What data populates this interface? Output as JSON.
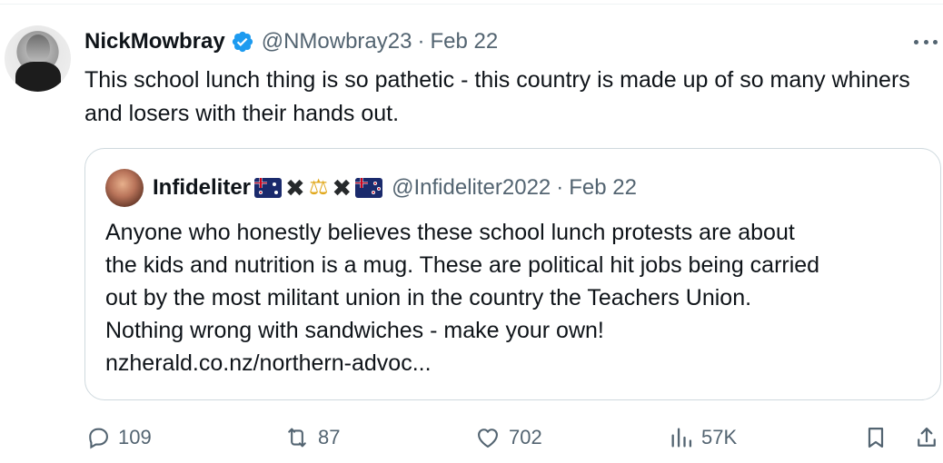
{
  "tweet": {
    "author_name": "NickMowbray",
    "handle": "@NMowbray23",
    "separator": "·",
    "date": "Feb 22",
    "text": "This school lunch thing is so pathetic - this country is made up of so many whiners and losers with their hands out.",
    "verified_icon": "verified-badge-icon",
    "more_icon": "more-horizontal-icon"
  },
  "quoted_tweet": {
    "author_name": "Infideliter",
    "name_emojis": [
      "🇦🇺",
      "✖",
      "⚖",
      "✖",
      "🇳🇿"
    ],
    "handle": "@Infideliter2022",
    "separator": "·",
    "date": "Feb 22",
    "text_lines": [
      "Anyone who honestly believes these school lunch protests are about",
      "the kids and nutrition is a mug. These are political hit jobs being carried",
      "out by the most militant union in the country the Teachers Union.",
      "Nothing wrong with sandwiches - make your own!",
      "nzherald.co.nz/northern-advoc..."
    ]
  },
  "actions": {
    "replies": "109",
    "reposts": "87",
    "likes": "702",
    "views": "57K"
  },
  "colors": {
    "text": "#0f1419",
    "secondary": "#536471",
    "verified": "#1d9bf0",
    "border": "#cfd9de"
  }
}
